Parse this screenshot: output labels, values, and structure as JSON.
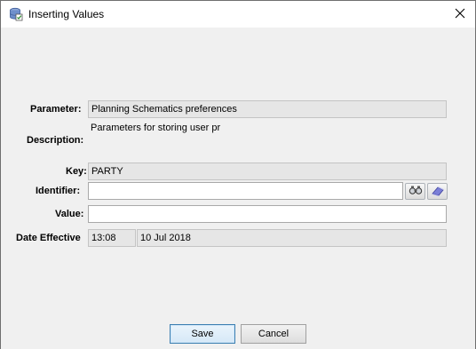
{
  "window": {
    "title": "Inserting Values",
    "app_icon": "database-icon",
    "close_icon": "close-icon"
  },
  "form": {
    "parameter": {
      "label": "Parameter:",
      "value": "Planning Schematics preferences"
    },
    "description": {
      "label": "Description:",
      "value": "Parameters for storing user pr"
    },
    "key": {
      "label": "Key:",
      "value": "PARTY"
    },
    "identifier": {
      "label": "Identifier:",
      "value": "",
      "lookup_icon": "binoculars-icon",
      "clear_icon": "eraser-icon"
    },
    "value": {
      "label": "Value:",
      "value": ""
    },
    "date_effective": {
      "label": "Date Effective",
      "time": "13:08",
      "date": "10 Jul 2018"
    }
  },
  "buttons": {
    "save": "Save",
    "cancel": "Cancel"
  }
}
